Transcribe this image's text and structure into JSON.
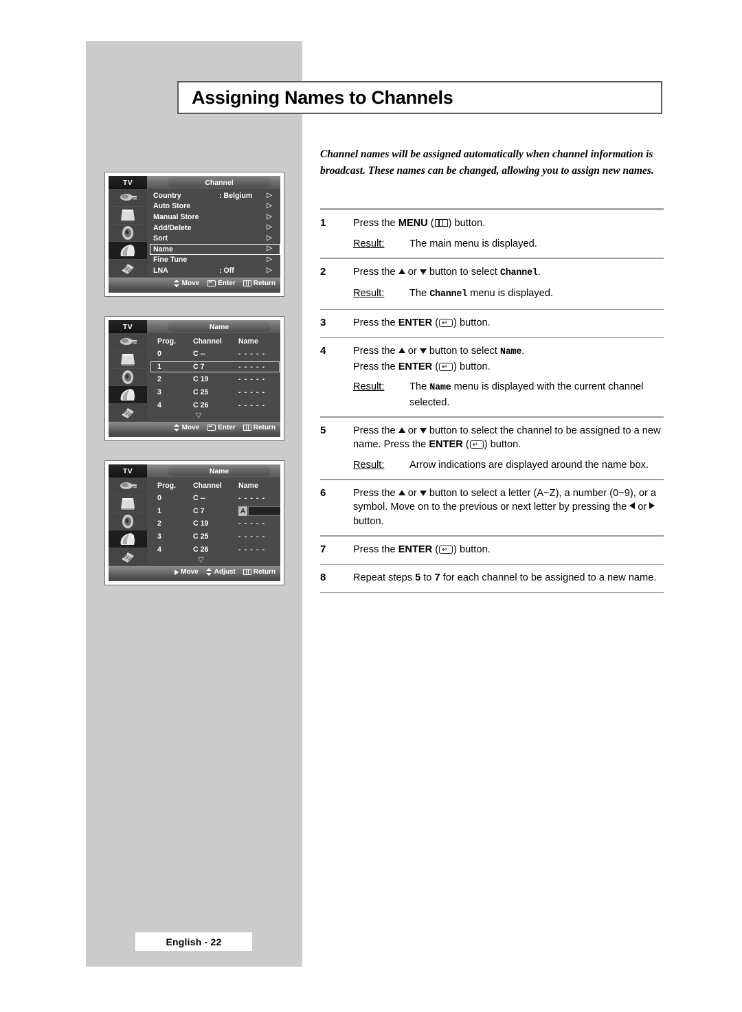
{
  "page": {
    "title": "Assigning Names to Channels",
    "intro": "Channel names will be assigned automatically when channel information is broadcast. These names can be changed, allowing you to assign new names.",
    "footer": "English - 22"
  },
  "steps": [
    {
      "num": "1",
      "line1_a": "Press the ",
      "line1_bold": "MENU",
      "line1_b": " (",
      "line1_c": ") button.",
      "result_label": "Result:",
      "result_text": "The main menu is displayed."
    },
    {
      "num": "2",
      "line1_a": "Press the ",
      "line1_b": " or ",
      "line1_c": " button to select ",
      "line1_mono": "Channel",
      "line1_d": ".",
      "result_label": "Result:",
      "result_a": "The ",
      "result_mono": "Channel",
      "result_b": " menu is displayed."
    },
    {
      "num": "3",
      "line1_a": "Press the ",
      "line1_bold": "ENTER",
      "line1_b": " (",
      "line1_c": ") button."
    },
    {
      "num": "4",
      "line1_a": "Press the ",
      "line1_b": " or ",
      "line1_c": " button to select ",
      "line1_mono": "Name",
      "line1_d": ".",
      "line2_a": "Press the ",
      "line2_bold": "ENTER",
      "line2_b": " (",
      "line2_c": ") button.",
      "result_label": "Result:",
      "result_a": "The ",
      "result_mono": "Name",
      "result_b": " menu is displayed with the current channel selected."
    },
    {
      "num": "5",
      "line1_a": "Press the ",
      "line1_b": " or ",
      "line1_c": " button to select the channel to be assigned to a new name.  Press the ",
      "line1_bold": "ENTER",
      "line1_d": " (",
      "line1_e": ") button.",
      "result_label": "Result:",
      "result_text": "Arrow indications are displayed around the name box."
    },
    {
      "num": "6",
      "line1_a": "Press the ",
      "line1_b": " or ",
      "line1_c": " button to select a letter (A~Z), a number (0~9), or a symbol. Move on to the previous or next letter by pressing the ",
      "line1_d": " or ",
      "line1_e": " button."
    },
    {
      "num": "7",
      "line1_a": "Press the ",
      "line1_bold": "ENTER",
      "line1_b": " (",
      "line1_c": ") button."
    },
    {
      "num": "8",
      "line1_a": "Repeat steps ",
      "line1_bold1": "5",
      "line1_b": " to ",
      "line1_bold2": "7",
      "line1_c": " for each channel to be assigned to a new name."
    }
  ],
  "osd": {
    "tv_label": "TV",
    "rail_icons": [
      "antenna-icon",
      "picture-tv-icon",
      "speaker-icon",
      "channel-dish-icon",
      "setup-hand-icon"
    ],
    "selected_rail_index": 3,
    "panel1": {
      "title": "Channel",
      "rows": [
        {
          "label": "Country",
          "value": ": Belgium",
          "selected": false
        },
        {
          "label": "Auto Store",
          "value": "",
          "selected": false
        },
        {
          "label": "Manual Store",
          "value": "",
          "selected": false
        },
        {
          "label": "Add/Delete",
          "value": "",
          "selected": false
        },
        {
          "label": "Sort",
          "value": "",
          "selected": false
        },
        {
          "label": "Name",
          "value": "",
          "selected": true
        },
        {
          "label": "Fine Tune",
          "value": "",
          "selected": false
        },
        {
          "label": "LNA",
          "value": ": Off",
          "selected": false
        }
      ],
      "footer": [
        {
          "icon": "up-down-arrows-icon",
          "label": "Move"
        },
        {
          "icon": "enter-key-icon",
          "label": "Enter"
        },
        {
          "icon": "menu-key-icon",
          "label": "Return"
        }
      ]
    },
    "panel2": {
      "title": "Name",
      "headers": [
        "Prog.",
        "Channel",
        "Name"
      ],
      "rows": [
        {
          "prog": "0",
          "channel": "C --",
          "name": "- - - - -",
          "selected": false
        },
        {
          "prog": "1",
          "channel": "C 7",
          "name": "- - - - -",
          "selected": true
        },
        {
          "prog": "2",
          "channel": "C 19",
          "name": "- - - - -",
          "selected": false
        },
        {
          "prog": "3",
          "channel": "C 25",
          "name": "- - - - -",
          "selected": false
        },
        {
          "prog": "4",
          "channel": "C 26",
          "name": "- - - - -",
          "selected": false
        }
      ],
      "more_indicator": "▽",
      "footer": [
        {
          "icon": "up-down-arrows-icon",
          "label": "Move"
        },
        {
          "icon": "enter-key-icon",
          "label": "Enter"
        },
        {
          "icon": "menu-key-icon",
          "label": "Return"
        }
      ]
    },
    "panel3": {
      "title": "Name",
      "headers": [
        "Prog.",
        "Channel",
        "Name"
      ],
      "rows": [
        {
          "prog": "0",
          "channel": "C --",
          "name": "- - - - -",
          "editing": false
        },
        {
          "prog": "1",
          "channel": "C 7",
          "name": "",
          "editing": true,
          "edit_char": "A"
        },
        {
          "prog": "2",
          "channel": "C 19",
          "name": "- - - - -",
          "editing": false
        },
        {
          "prog": "3",
          "channel": "C 25",
          "name": "- - - - -",
          "editing": false
        },
        {
          "prog": "4",
          "channel": "C 26",
          "name": "- - - - -",
          "editing": false
        }
      ],
      "more_indicator": "▽",
      "footer": [
        {
          "icon": "right-arrow-icon",
          "label": "Move"
        },
        {
          "icon": "up-down-arrows-icon",
          "label": "Adjust"
        },
        {
          "icon": "menu-key-icon",
          "label": "Return"
        }
      ]
    }
  }
}
